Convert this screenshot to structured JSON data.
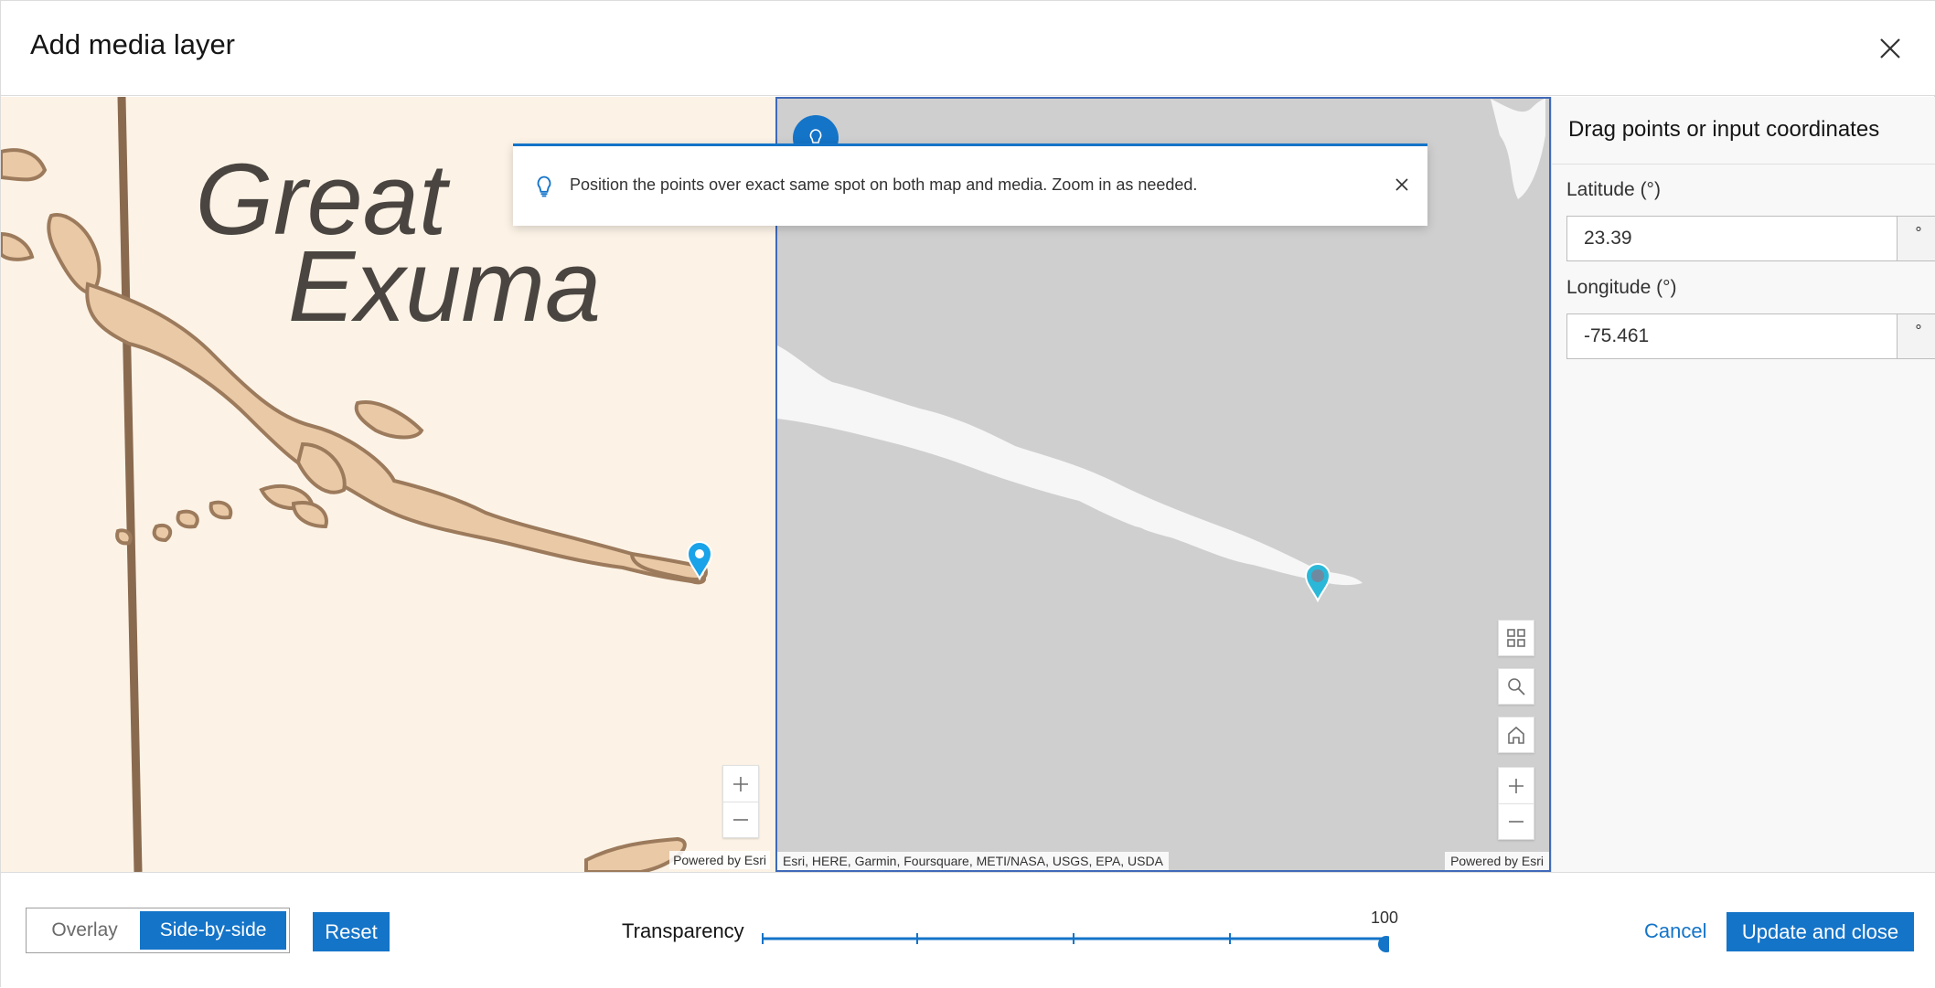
{
  "header": {
    "title": "Add media layer",
    "close_icon": "close-icon"
  },
  "media_map": {
    "label_line1": "Great",
    "label_line2": "Exuma",
    "attribution": "Powered by Esri",
    "zoom_in_icon": "plus-icon",
    "zoom_out_icon": "minus-icon",
    "pin_color": "#1aa3e8"
  },
  "base_map": {
    "attribution_left": "Esri, HERE, Garmin, Foursquare, METI/NASA, USGS, EPA, USDA",
    "attribution_right": "Powered by Esri",
    "tools": [
      "expand-icon",
      "search-icon",
      "home-icon",
      "plus-icon",
      "minus-icon"
    ],
    "pin_color": "#2bb8d8",
    "tip_icon": "lightbulb-icon"
  },
  "notice": {
    "text": "Position the points over exact same spot on both map and media. Zoom in as needed.",
    "icon": "lightbulb-icon"
  },
  "coordinates": {
    "title": "Drag points or input coordinates",
    "latitude_label": "Latitude (°)",
    "latitude_value": "23.39",
    "latitude_suffix": "°",
    "longitude_label": "Longitude (°)",
    "longitude_value": "-75.461",
    "longitude_suffix": "°"
  },
  "footer": {
    "mode_overlay": "Overlay",
    "mode_side_by_side": "Side-by-side",
    "selected_mode": "Side-by-side",
    "reset_label": "Reset",
    "transparency_label": "Transparency",
    "transparency_value": "100",
    "cancel_label": "Cancel",
    "update_label": "Update and close"
  },
  "colors": {
    "accent": "#1474c8",
    "map_land": "#eac9a6",
    "map_water": "#fcf3e6",
    "basemap_water": "#cfcfcf",
    "basemap_land": "#f6f6f6"
  }
}
